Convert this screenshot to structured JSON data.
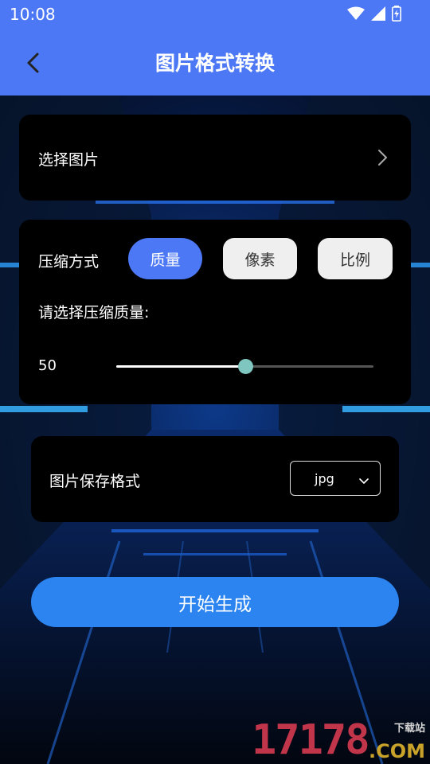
{
  "status_bar": {
    "time": "10:08"
  },
  "header": {
    "title": "图片格式转换"
  },
  "select_image": {
    "label": "选择图片"
  },
  "compression": {
    "mode_label": "压缩方式",
    "options": [
      "质量",
      "像素",
      "比例"
    ],
    "selected": "质量",
    "quality_prompt": "请选择压缩质量:",
    "quality_value": "50",
    "quality_fraction": 0.5
  },
  "save_format": {
    "label": "图片保存格式",
    "value": "jpg"
  },
  "action": {
    "generate_label": "开始生成"
  },
  "watermark": {
    "number": "17178",
    "site_label": "下载站",
    "domain": ".COM"
  },
  "colors": {
    "accent": "#4d78f5",
    "button": "#2b84f0",
    "thumb": "#7ec6bf"
  }
}
